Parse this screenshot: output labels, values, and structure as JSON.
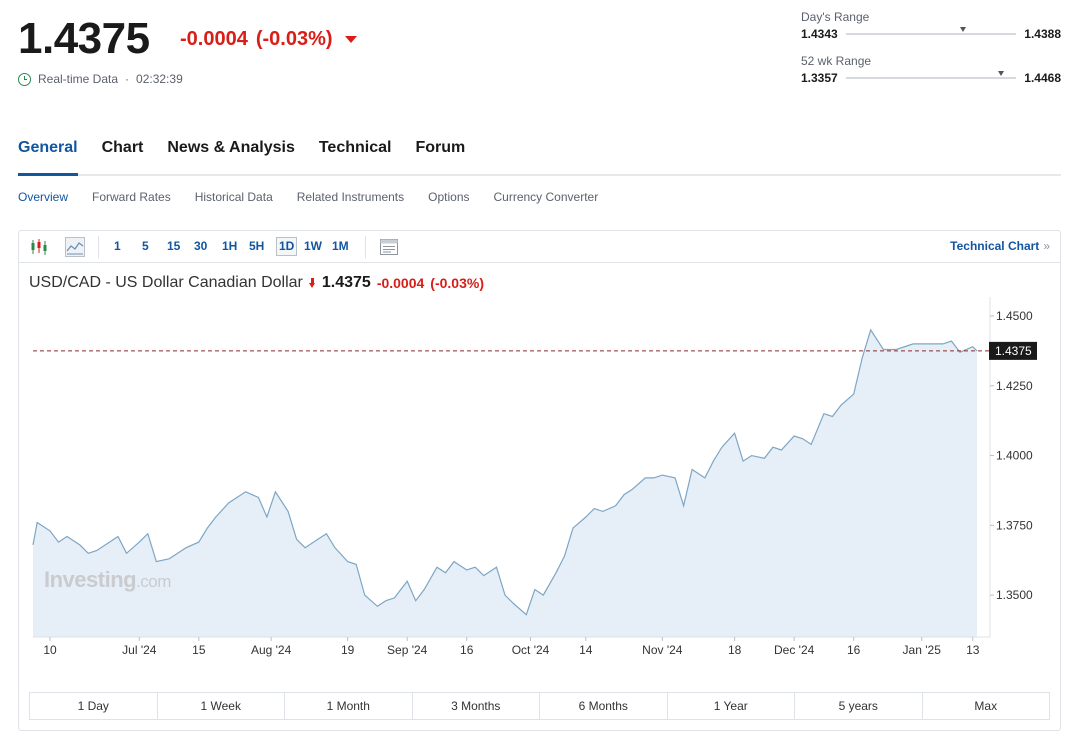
{
  "quote": {
    "price": "1.4375",
    "change": "-0.0004",
    "change_pct": "(-0.03%)",
    "realtime_label": "Real-time Data",
    "time": "02:32:39"
  },
  "days_range": {
    "label": "Day's Range",
    "low": "1.4343",
    "high": "1.4388",
    "position": 0.69
  },
  "week52_range": {
    "label": "52 wk Range",
    "low": "1.3357",
    "high": "1.4468",
    "position": 0.91
  },
  "tabs": [
    {
      "label": "General",
      "active": true
    },
    {
      "label": "Chart"
    },
    {
      "label": "News & Analysis"
    },
    {
      "label": "Technical"
    },
    {
      "label": "Forum"
    }
  ],
  "subtabs": [
    {
      "label": "Overview",
      "active": true
    },
    {
      "label": "Forward Rates"
    },
    {
      "label": "Historical Data"
    },
    {
      "label": "Related Instruments"
    },
    {
      "label": "Options"
    },
    {
      "label": "Currency Converter"
    }
  ],
  "toolbar": {
    "timeframes": [
      "1",
      "5",
      "15",
      "30",
      "1H",
      "5H",
      "1D",
      "1W",
      "1M"
    ],
    "selected_timeframe": "1D",
    "technical_chart_label": "Technical Chart",
    "technical_chart_suffix": "»"
  },
  "chart_title": {
    "name": "USD/CAD - US Dollar Canadian Dollar",
    "price": "1.4375",
    "change": "-0.0004",
    "change_pct": "(-0.03%)"
  },
  "watermark": {
    "brand": "Investing",
    "suffix": ".com"
  },
  "periods": [
    "1 Day",
    "1 Week",
    "1 Month",
    "3 Months",
    "6 Months",
    "1 Year",
    "5 years",
    "Max"
  ],
  "colors": {
    "accent": "#1256a0",
    "negative": "#d91e18",
    "line": "#7ea6c4",
    "fill": "#e6eff7"
  },
  "chart_data": {
    "type": "area",
    "title": "",
    "ylim": [
      1.335,
      1.4525
    ],
    "yticks": [
      1.35,
      1.375,
      1.4,
      1.425,
      1.45
    ],
    "ytick_labels": [
      "1.3500",
      "1.3750",
      "1.4000",
      "1.4250",
      "1.4500"
    ],
    "current_value": 1.4375,
    "current_label": "1.4375",
    "xlim": [
      "2024-06-10",
      "2025-01-14"
    ],
    "xticks": [
      {
        "date": "2024-06-10",
        "label": "10"
      },
      {
        "date": "2024-07-01",
        "label": "Jul '24"
      },
      {
        "date": "2024-07-15",
        "label": "15"
      },
      {
        "date": "2024-08-01",
        "label": "Aug '24"
      },
      {
        "date": "2024-08-19",
        "label": "19"
      },
      {
        "date": "2024-09-02",
        "label": "Sep '24"
      },
      {
        "date": "2024-09-16",
        "label": "16"
      },
      {
        "date": "2024-10-01",
        "label": "Oct '24"
      },
      {
        "date": "2024-10-14",
        "label": "14"
      },
      {
        "date": "2024-11-01",
        "label": "Nov '24"
      },
      {
        "date": "2024-11-18",
        "label": "18"
      },
      {
        "date": "2024-12-02",
        "label": "Dec '24"
      },
      {
        "date": "2024-12-16",
        "label": "16"
      },
      {
        "date": "2025-01-01",
        "label": "Jan '25"
      },
      {
        "date": "2025-01-13",
        "label": "13"
      }
    ],
    "x": [
      "2024-06-05",
      "2024-06-07",
      "2024-06-10",
      "2024-06-12",
      "2024-06-14",
      "2024-06-17",
      "2024-06-19",
      "2024-06-21",
      "2024-06-24",
      "2024-06-26",
      "2024-06-28",
      "2024-07-01",
      "2024-07-03",
      "2024-07-05",
      "2024-07-08",
      "2024-07-10",
      "2024-07-12",
      "2024-07-15",
      "2024-07-17",
      "2024-07-19",
      "2024-07-22",
      "2024-07-24",
      "2024-07-26",
      "2024-07-29",
      "2024-07-31",
      "2024-08-02",
      "2024-08-05",
      "2024-08-07",
      "2024-08-09",
      "2024-08-12",
      "2024-08-14",
      "2024-08-16",
      "2024-08-19",
      "2024-08-21",
      "2024-08-23",
      "2024-08-26",
      "2024-08-28",
      "2024-08-30",
      "2024-09-02",
      "2024-09-04",
      "2024-09-06",
      "2024-09-09",
      "2024-09-11",
      "2024-09-13",
      "2024-09-16",
      "2024-09-18",
      "2024-09-20",
      "2024-09-23",
      "2024-09-25",
      "2024-09-27",
      "2024-09-30",
      "2024-10-02",
      "2024-10-04",
      "2024-10-07",
      "2024-10-09",
      "2024-10-11",
      "2024-10-14",
      "2024-10-16",
      "2024-10-18",
      "2024-10-21",
      "2024-10-23",
      "2024-10-25",
      "2024-10-28",
      "2024-10-30",
      "2024-11-01",
      "2024-11-04",
      "2024-11-06",
      "2024-11-08",
      "2024-11-11",
      "2024-11-13",
      "2024-11-15",
      "2024-11-18",
      "2024-11-20",
      "2024-11-22",
      "2024-11-25",
      "2024-11-27",
      "2024-11-29",
      "2024-12-02",
      "2024-12-04",
      "2024-12-06",
      "2024-12-09",
      "2024-12-11",
      "2024-12-13",
      "2024-12-16",
      "2024-12-18",
      "2024-12-20",
      "2024-12-23",
      "2024-12-26",
      "2024-12-30",
      "2025-01-01",
      "2025-01-03",
      "2025-01-06",
      "2025-01-08",
      "2025-01-10",
      "2025-01-13",
      "2025-01-14"
    ],
    "series": [
      {
        "values": [
          1.368,
          1.376,
          1.373,
          1.369,
          1.371,
          1.368,
          1.365,
          1.366,
          1.369,
          1.371,
          1.365,
          1.369,
          1.372,
          1.362,
          1.363,
          1.365,
          1.367,
          1.369,
          1.374,
          1.378,
          1.383,
          1.385,
          1.387,
          1.385,
          1.378,
          1.387,
          1.38,
          1.37,
          1.367,
          1.37,
          1.372,
          1.367,
          1.362,
          1.361,
          1.35,
          1.346,
          1.348,
          1.349,
          1.355,
          1.348,
          1.352,
          1.36,
          1.358,
          1.362,
          1.359,
          1.36,
          1.357,
          1.36,
          1.35,
          1.347,
          1.343,
          1.352,
          1.35,
          1.358,
          1.364,
          1.374,
          1.378,
          1.381,
          1.38,
          1.382,
          1.386,
          1.388,
          1.392,
          1.392,
          1.393,
          1.392,
          1.382,
          1.395,
          1.392,
          1.398,
          1.403,
          1.408,
          1.398,
          1.4,
          1.399,
          1.403,
          1.402,
          1.407,
          1.406,
          1.404,
          1.415,
          1.414,
          1.418,
          1.422,
          1.435,
          1.445,
          1.438,
          1.438,
          1.44,
          1.44,
          1.44,
          1.44,
          1.441,
          1.437,
          1.439,
          1.4375
        ]
      }
    ]
  }
}
